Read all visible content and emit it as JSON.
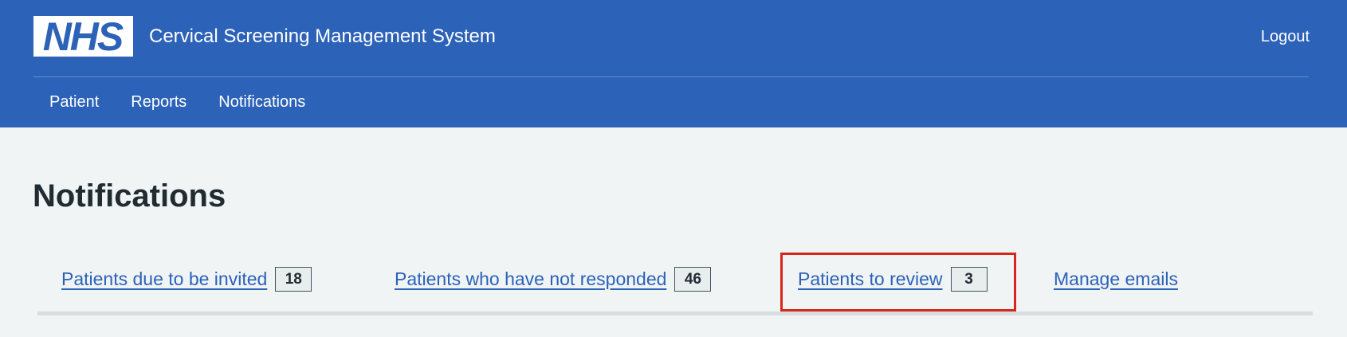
{
  "header": {
    "logo_text": "NHS",
    "service_name": "Cervical Screening Management System",
    "logout_label": "Logout",
    "nav": [
      {
        "label": "Patient"
      },
      {
        "label": "Reports"
      },
      {
        "label": "Notifications"
      }
    ]
  },
  "main": {
    "title": "Notifications",
    "tabs": [
      {
        "label": "Patients due to be invited",
        "count": "18",
        "selected": false
      },
      {
        "label": "Patients who have not responded",
        "count": "46",
        "selected": false
      },
      {
        "label": "Patients to review",
        "count": "3",
        "selected": true
      },
      {
        "label": "Manage emails",
        "selected": false
      }
    ]
  },
  "colors": {
    "header_bg": "#2c62b8",
    "page_bg": "#f0f4f5",
    "link": "#2c62b8",
    "highlight_border": "#d5281b"
  },
  "icons": {
    "logo": "nhs-logo"
  }
}
